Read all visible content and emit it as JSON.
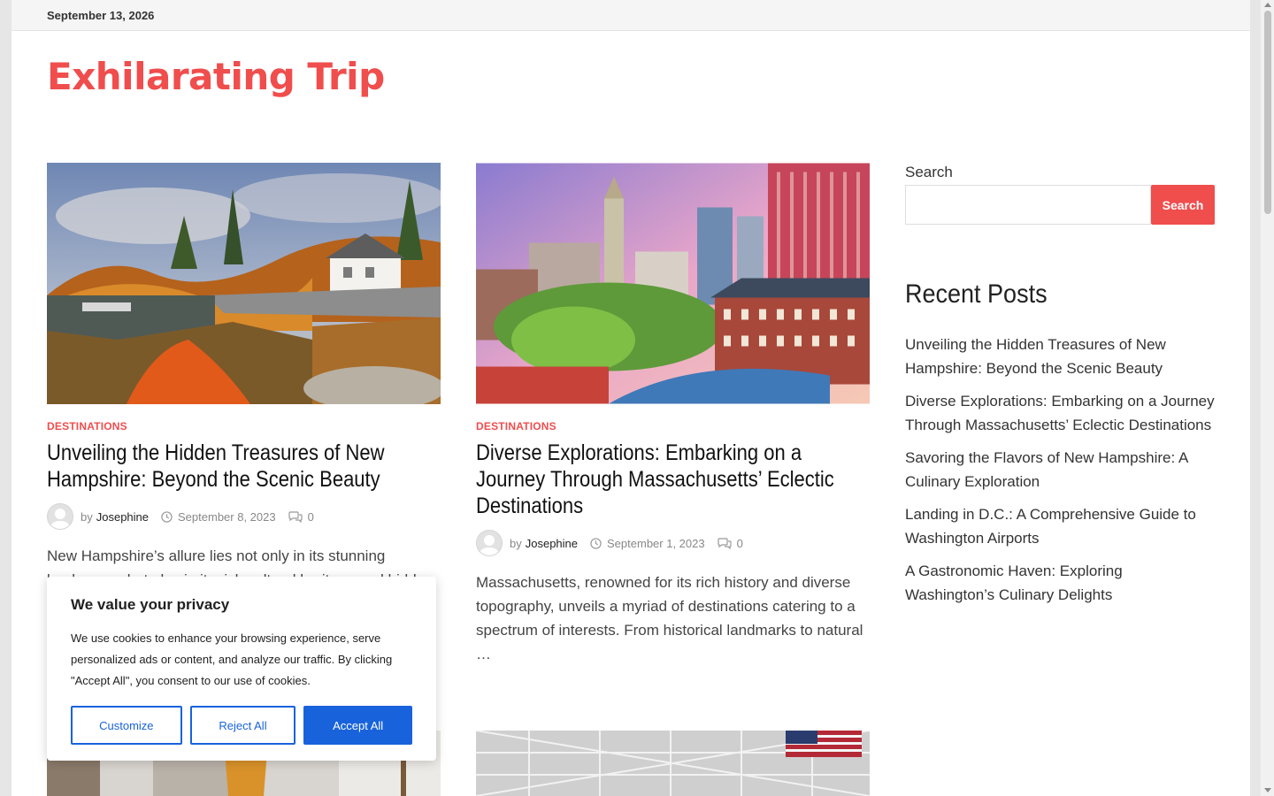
{
  "topbar": {
    "date": "September 13, 2026"
  },
  "site": {
    "title": "Exhilarating Trip"
  },
  "posts": [
    {
      "category": "DESTINATIONS",
      "title": "Unveiling the Hidden Treasures of New Hampshire: Beyond the Scenic Beauty",
      "by": "by",
      "author": "Josephine",
      "date": "September 8, 2023",
      "comments": "0",
      "excerpt": "New Hampshire’s allure lies not only in its stunning landscapes but also in its rich cultural heritage and hidden"
    },
    {
      "category": "DESTINATIONS",
      "title": "Diverse Explorations: Embarking on a Journey Through Massachusetts’ Eclectic Destinations",
      "by": "by",
      "author": "Josephine",
      "date": "September 1, 2023",
      "comments": "0",
      "excerpt": "Massachusetts, renowned for its rich history and diverse topography, unveils a myriad of destinations catering to a spectrum of interests. From historical landmarks to natural …"
    }
  ],
  "sidebar": {
    "search_label": "Search",
    "search_button": "Search",
    "recent_title": "Recent Posts",
    "recent_posts": [
      "Unveiling the Hidden Treasures of New Hampshire: Beyond the Scenic Beauty",
      "Diverse Explorations: Embarking on a Journey Through Massachusetts’ Eclectic Destinations",
      "Savoring the Flavors of New Hampshire: A Culinary Exploration",
      "Landing in D.C.: A Comprehensive Guide to Washington Airports",
      "A Gastronomic Haven: Exploring Washington’s Culinary Delights"
    ]
  },
  "cookie": {
    "title": "We value your privacy",
    "text": "We use cookies to enhance your browsing experience, serve personalized ads or content, and analyze our traffic. By clicking \"Accept All\", you consent to our use of cookies.",
    "customize": "Customize",
    "reject": "Reject All",
    "accept": "Accept All"
  },
  "colors": {
    "accent": "#f04d4d",
    "cookie_blue": "#1863dc"
  },
  "icons": [
    "clock-icon",
    "comment-icon",
    "avatar-icon"
  ]
}
